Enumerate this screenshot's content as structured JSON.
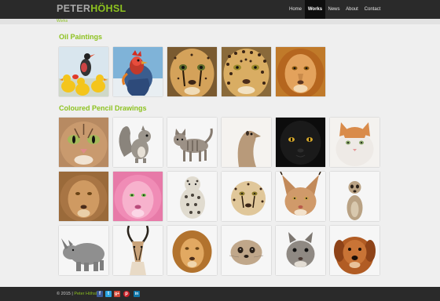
{
  "header": {
    "logo_part1": "PETER",
    "logo_part2": "HÖHSL",
    "nav": [
      "Home",
      "Works",
      "News",
      "About",
      "Contact"
    ],
    "active_nav": "Works"
  },
  "breadcrumb": "Works",
  "sections": [
    {
      "title": "Oil Paintings",
      "items": [
        "rubber-ducks-and-bird",
        "colourful-rooster",
        "cheetah-face",
        "leopard-face",
        "lion-face"
      ]
    },
    {
      "title": "Coloured Pencil Drawings",
      "items": [
        "cat-face",
        "squirrel",
        "tabby-kitten",
        "meerkat-profile",
        "black-panther",
        "ginger-white-cat",
        "lion-face",
        "pink-lion",
        "snow-leopard",
        "cheetah-head",
        "caracal",
        "meerkat-standing",
        "rhino",
        "gazelle",
        "lion",
        "meerkat-face",
        "squirrel-face",
        "dog"
      ]
    }
  ],
  "footer": {
    "copyright": "© 2015 |",
    "name": "Peter Höhsl",
    "social": [
      {
        "icon": "facebook-icon",
        "glyph": "f",
        "color": "#3b5998"
      },
      {
        "icon": "twitter-icon",
        "glyph": "t",
        "color": "#2aa3e0"
      },
      {
        "icon": "google-plus-icon",
        "glyph": "g+",
        "color": "#d34836"
      },
      {
        "icon": "pinterest-icon",
        "glyph": "p",
        "color": "#cb2027"
      },
      {
        "icon": "linkedin-icon",
        "glyph": "in",
        "color": "#0e76a8"
      }
    ]
  },
  "colors": {
    "accent": "#8dc21f",
    "topbar": "#2a2a2a",
    "background": "#efefef"
  }
}
